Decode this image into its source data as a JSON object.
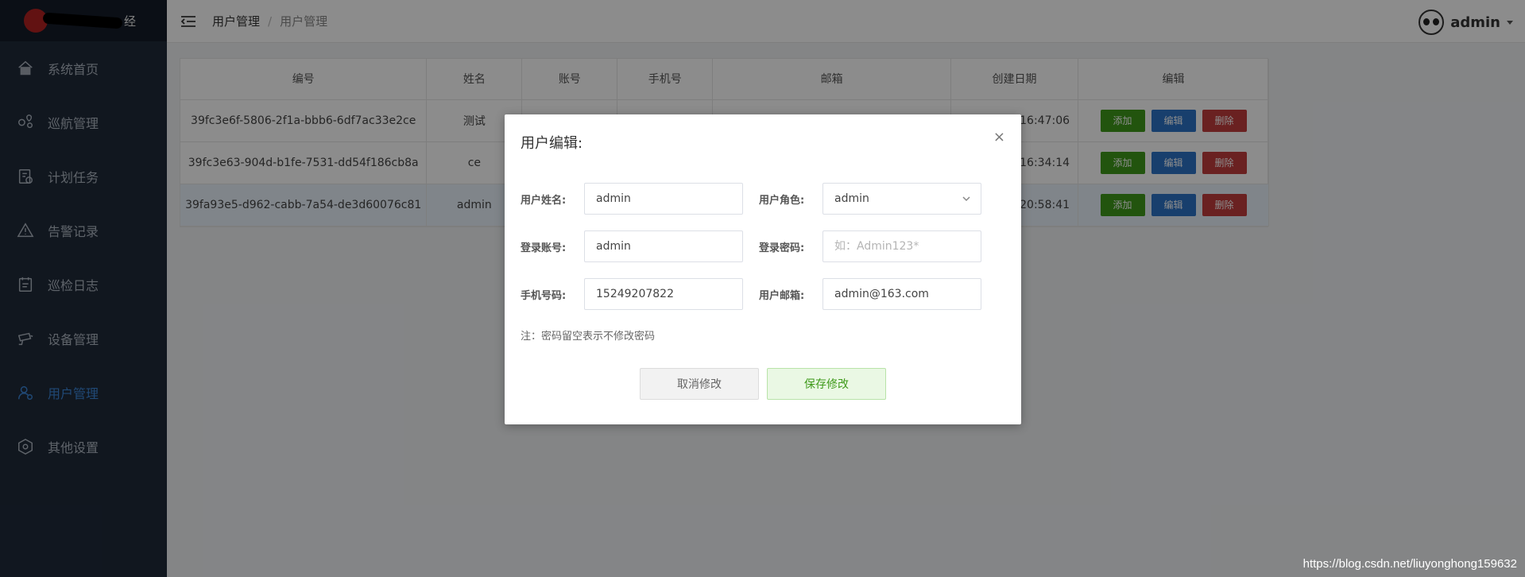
{
  "sidebar": {
    "logo_tail": "经",
    "items": [
      {
        "label": "系统首页",
        "icon": "home-icon"
      },
      {
        "label": "巡航管理",
        "icon": "route-icon"
      },
      {
        "label": "计划任务",
        "icon": "task-icon"
      },
      {
        "label": "告警记录",
        "icon": "warning-icon"
      },
      {
        "label": "巡检日志",
        "icon": "log-icon"
      },
      {
        "label": "设备管理",
        "icon": "camera-icon"
      },
      {
        "label": "用户管理",
        "icon": "user-icon",
        "active": true
      },
      {
        "label": "其他设置",
        "icon": "settings-icon"
      }
    ]
  },
  "header": {
    "breadcrumb": [
      "用户管理",
      "/",
      "用户管理"
    ],
    "user_name": "admin"
  },
  "table": {
    "headers": [
      "编号",
      "姓名",
      "账号",
      "手机号",
      "邮箱",
      "创建日期",
      "编辑"
    ],
    "rows": [
      {
        "id": "39fc3e6f-5806-2f1a-bbb6-6df7ac33e2ce",
        "name": "测试",
        "date": "16:47:06"
      },
      {
        "id": "39fc3e63-904d-b1fe-7531-dd54f186cb8a",
        "name": "ce",
        "date": "16:34:14"
      },
      {
        "id": "39fa93e5-d962-cabb-7a54-de3d60076c81",
        "name": "admin",
        "date": "20:58:41"
      }
    ],
    "actions": {
      "add": "添加",
      "edit": "编辑",
      "delete": "删除"
    }
  },
  "modal": {
    "title": "用户编辑:",
    "close": "×",
    "fields": {
      "name_label": "用户姓名:",
      "name_value": "admin",
      "role_label": "用户角色:",
      "role_value": "admin",
      "account_label": "登录账号:",
      "account_value": "admin",
      "password_label": "登录密码:",
      "password_placeholder": "如：Admin123*",
      "phone_label": "手机号码:",
      "phone_value": "15249207822",
      "email_label": "用户邮箱:",
      "email_value": "admin@163.com"
    },
    "note": "注：密码留空表示不修改密码",
    "cancel": "取消修改",
    "save": "保存修改"
  },
  "watermark": "https://blog.csdn.net/liuyonghong159632",
  "colors": {
    "sidebar_bg": "#1f2a3a",
    "active": "#3b86d8",
    "btn_add": "#3f9a1b",
    "btn_edit": "#2d74c6",
    "btn_delete": "#c23c3c"
  }
}
